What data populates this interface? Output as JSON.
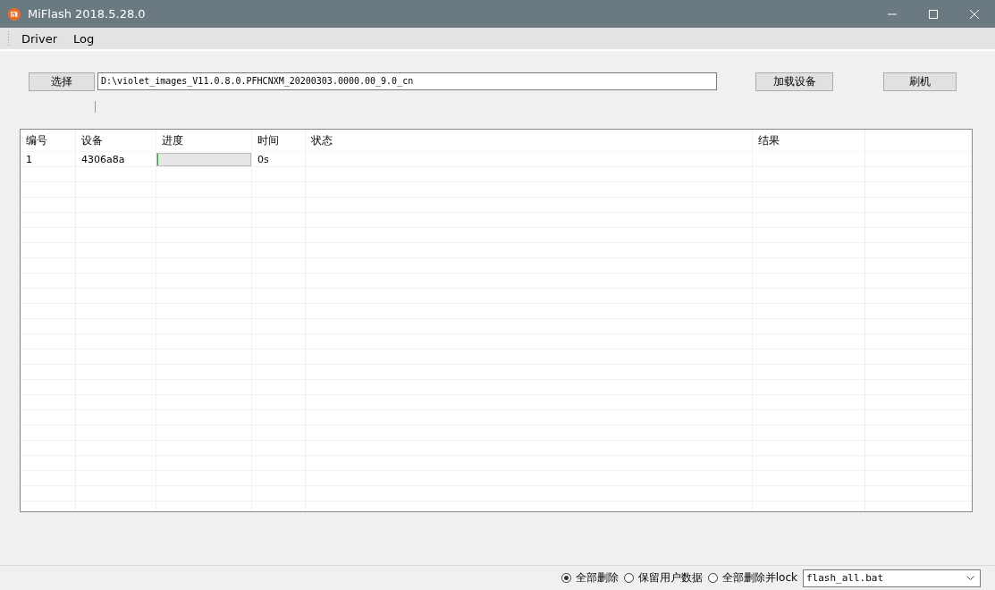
{
  "window": {
    "title": "MiFlash 2018.5.28.0"
  },
  "menu": [
    {
      "label": "Driver"
    },
    {
      "label": "Log"
    }
  ],
  "toolbar": {
    "select_button": "选择",
    "path": "D:\\violet_images_V11.0.8.0.PFHCNXM_20200303.0000.00_9.0_cn",
    "load_button": "加载设备",
    "flash_button": "刷机"
  },
  "table": {
    "columns": [
      "编号",
      "设备",
      "进度",
      "时间",
      "状态",
      "结果",
      ""
    ],
    "rows": [
      {
        "number": "1",
        "device": "4306a8a",
        "level": 0,
        "time": "0s"
      }
    ]
  },
  "status_bar": {
    "options": [
      {
        "label": "全部删除",
        "selected": true
      },
      {
        "label": "保留用户数据",
        "selected": false
      },
      {
        "label": "全部删除并lock",
        "selected": false
      }
    ],
    "script": "flash_all.bat"
  }
}
